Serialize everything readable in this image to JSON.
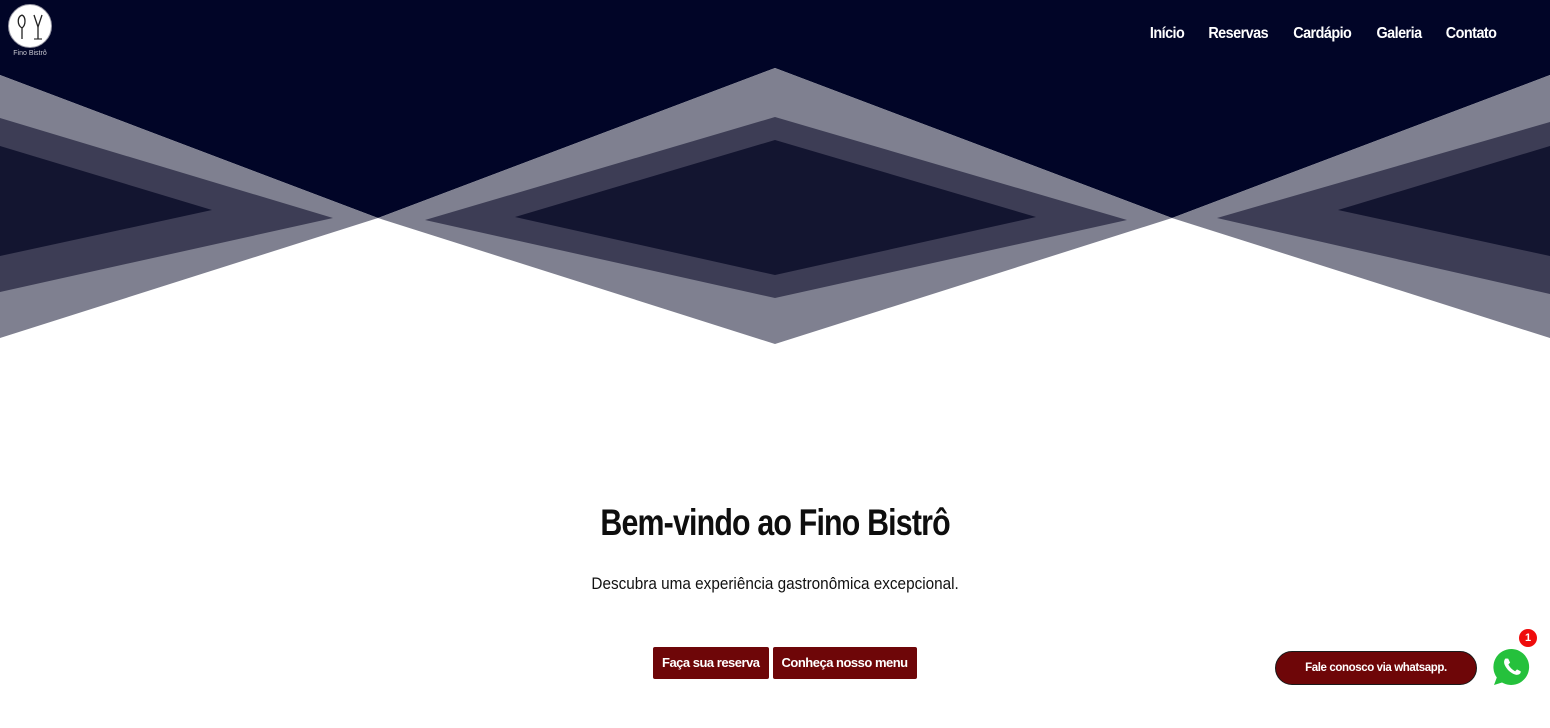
{
  "brand": {
    "name": "Fino Bistrô"
  },
  "nav": {
    "items": [
      {
        "label": "Início"
      },
      {
        "label": "Reservas"
      },
      {
        "label": "Cardápio"
      },
      {
        "label": "Galeria"
      },
      {
        "label": "Contato"
      }
    ]
  },
  "hero": {
    "title": "Bem-vindo ao Fino Bistrô",
    "subtitle": "Descubra uma experiência gastronômica excepcional.",
    "buttons": {
      "reserve": "Faça sua reserva",
      "menu": "Conheça nosso menu"
    }
  },
  "whatsapp": {
    "pill_label": "Fale conosco via whatsapp.",
    "badge_count": "1",
    "icon": "whatsapp-icon"
  },
  "colors": {
    "header_navy": "#010527",
    "stripe_light": "#7f8090",
    "stripe_mid": "#3d3d55",
    "stripe_dark": "#131530",
    "accent_burgundy": "#6e0608",
    "whatsapp_green": "#25c13c",
    "badge_red": "#ef0c0c"
  }
}
